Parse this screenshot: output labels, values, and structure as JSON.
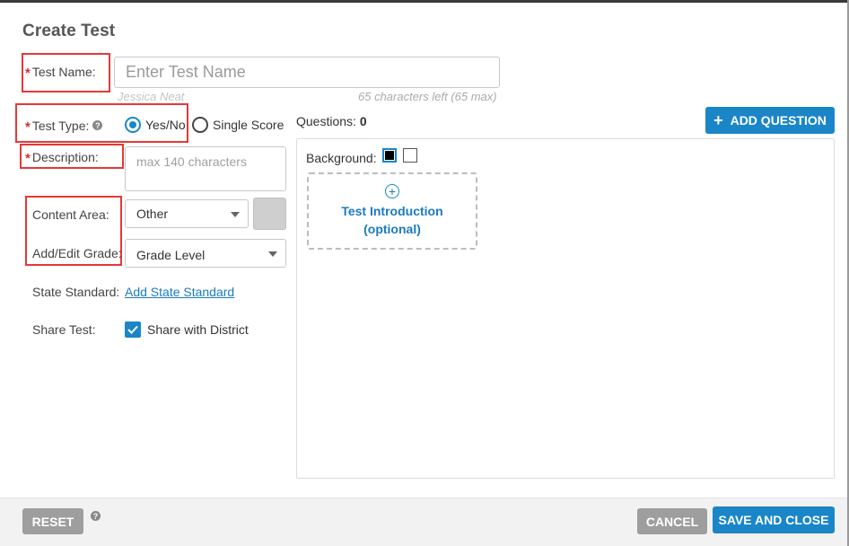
{
  "dialog": {
    "title": "Create Test"
  },
  "form": {
    "required_mark": "*",
    "test_name_label": "Test Name:",
    "test_name_placeholder": "Enter Test Name",
    "author_hint": "Jessica Neat",
    "chars_hint": "65 characters left (65 max)",
    "test_type_label": "Test Type:",
    "test_type_options": [
      "Yes/No",
      "Single Score"
    ],
    "test_type_selected": "Yes/No",
    "description_label": "Description:",
    "description_placeholder": "max 140 characters",
    "content_area_label": "Content Area:",
    "content_area_value": "Other",
    "grade_label": "Add/Edit Grade:",
    "grade_value": "Grade Level",
    "state_standard_label": "State Standard:",
    "state_standard_link": "Add State Standard",
    "share_label": "Share Test:",
    "share_checkbox_label": "Share with District",
    "share_checked": true
  },
  "questions_panel": {
    "questions_label": "Questions:",
    "questions_count": "0",
    "add_question_label": "ADD QUESTION",
    "background_label": "Background:",
    "background_options": [
      "#000000",
      "#ffffff"
    ],
    "background_selected": "#000000",
    "intro_line1": "Test Introduction",
    "intro_line2": "(optional)"
  },
  "footer": {
    "reset_label": "RESET",
    "cancel_label": "CANCEL",
    "save_label": "SAVE AND CLOSE"
  },
  "colors": {
    "accent": "#1a86c8",
    "required": "#d32f2f",
    "annotation_box": "#e53935",
    "grey_button": "#9e9e9e"
  },
  "icons": {
    "help": "question-circle-icon",
    "add": "plus-icon",
    "intro_add": "plus-circle-icon",
    "dropdown": "caret-down-icon",
    "check": "check-icon"
  }
}
